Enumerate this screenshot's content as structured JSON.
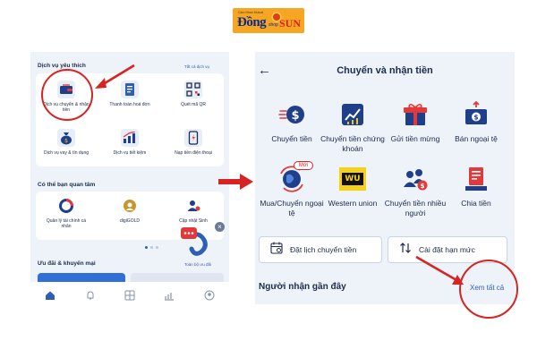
{
  "logo": {
    "tagline": "Cam Nhan Mutual",
    "word1": "Đồng",
    "small": "shop",
    "word2": "SUN"
  },
  "left": {
    "favorites_title": "Dịch vụ yêu thích",
    "favorites_link": "Tất cả dịch vụ",
    "favorites": [
      {
        "label": "Dịch vụ chuyển & nhận tiền",
        "icon": "wallet-transfer-icon"
      },
      {
        "label": "Thanh toán hoá đơn",
        "icon": "bill-icon"
      },
      {
        "label": "Quét mã QR",
        "icon": "qr-code-icon"
      },
      {
        "label": "Dịch vụ vay & tín dụng",
        "icon": "money-bag-icon"
      },
      {
        "label": "Dịch vụ tiết kiệm",
        "icon": "savings-chart-icon"
      },
      {
        "label": "Nạp tiền điện thoại",
        "icon": "phone-topup-icon"
      }
    ],
    "interest_title": "Có thể bạn quan tâm",
    "interest": [
      {
        "label": "Quản lý tài chính cá nhân",
        "icon": "pie-chart-icon"
      },
      {
        "label": "digiGOLD",
        "icon": "gold-icon"
      },
      {
        "label": "Cập nhật Sinh",
        "icon": "user-update-icon"
      }
    ],
    "promo_title": "Ưu đãi & khuyến mại",
    "promo_link": "Toàn bộ ưu đãi",
    "nav": [
      "home-icon",
      "bell-icon",
      "grid-icon",
      "chart-icon",
      "user-icon"
    ]
  },
  "right": {
    "title": "Chuyển và nhận tiền",
    "services": [
      {
        "label": "Chuyển tiền",
        "icon": "send-money-icon"
      },
      {
        "label": "Chuyển tiền chứng khoán",
        "icon": "stock-transfer-icon"
      },
      {
        "label": "Gửi tiền mừng",
        "icon": "gift-icon"
      },
      {
        "label": "Bán ngoại tệ",
        "icon": "sell-currency-icon"
      },
      {
        "label": "Mua/Chuyển ngoại tệ",
        "icon": "globe-exchange-icon"
      },
      {
        "label": "Western union",
        "icon": "western-union-icon"
      },
      {
        "label": "Chuyển tiền nhiều người",
        "icon": "group-transfer-icon"
      },
      {
        "label": "Chia tiền",
        "icon": "split-bill-icon"
      }
    ],
    "new_badge": "Mới",
    "wu_logo": "WU",
    "schedule_label": "Đặt lịch chuyển tiền",
    "limit_label": "Cài đặt hạn mức",
    "recent_title": "Người nhận gần đây",
    "see_all": "Xem tất cả"
  },
  "colors": {
    "accent": "#2f5fb5",
    "annotation": "#d82323",
    "background": "#eef3fa"
  }
}
